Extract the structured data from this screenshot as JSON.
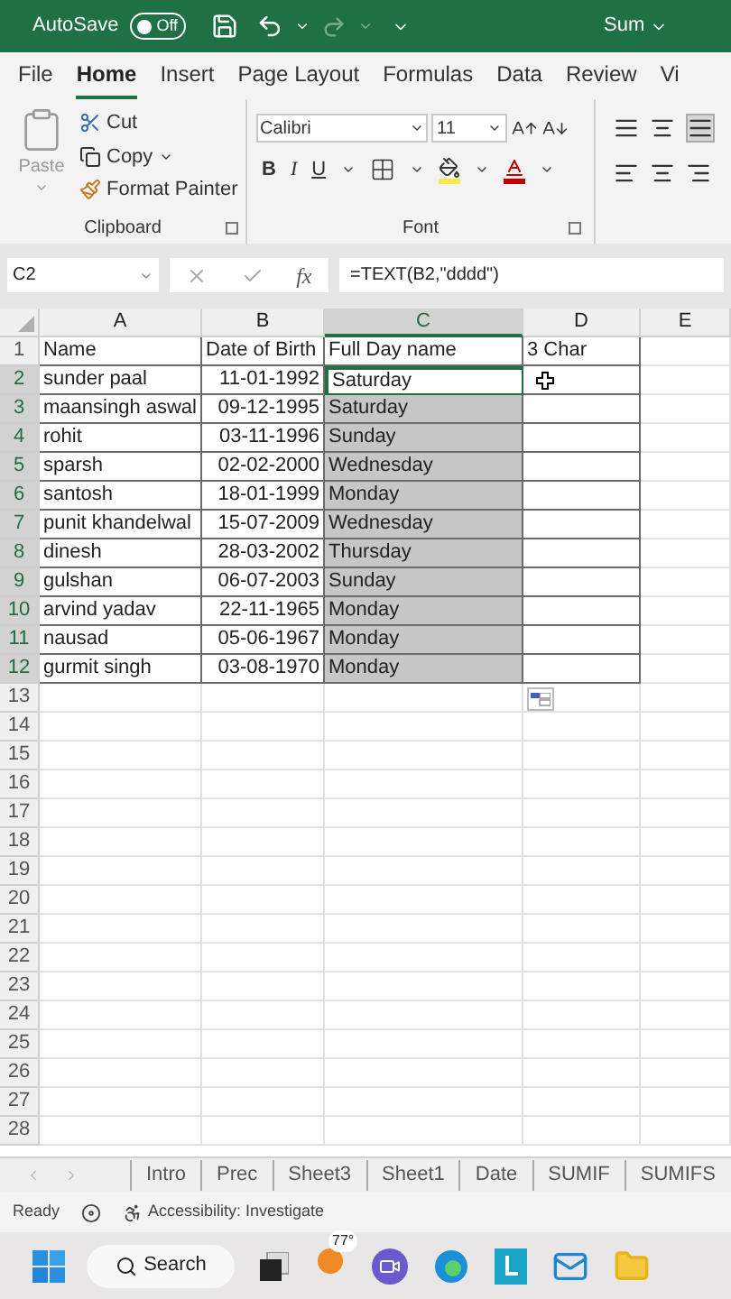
{
  "title_bar": {
    "autosave_label": "AutoSave",
    "autosave_state": "Off",
    "autosave_on": false,
    "title": "Sum"
  },
  "ribbon_tabs": [
    {
      "label": "File",
      "selected": false
    },
    {
      "label": "Home",
      "selected": true
    },
    {
      "label": "Insert",
      "selected": false
    },
    {
      "label": "Page Layout",
      "selected": false
    },
    {
      "label": "Formulas",
      "selected": false
    },
    {
      "label": "Data",
      "selected": false
    },
    {
      "label": "Review",
      "selected": false
    },
    {
      "label": "Vi",
      "selected": false
    }
  ],
  "clipboard": {
    "paste": "Paste",
    "cut": "Cut",
    "copy": "Copy",
    "format_painter": "Format Painter",
    "group_label": "Clipboard"
  },
  "font": {
    "family": "Calibri",
    "size": "11",
    "bold": "B",
    "italic": "I",
    "underline": "U",
    "group_label": "Font"
  },
  "formula_bar": {
    "name_box": "C2",
    "fx": "fx",
    "formula": "=TEXT(B2,\"dddd\")"
  },
  "sheet": {
    "columns": [
      {
        "label": "A",
        "selected": false
      },
      {
        "label": "B",
        "selected": false
      },
      {
        "label": "C",
        "selected": true
      },
      {
        "label": "D",
        "selected": false
      },
      {
        "label": "E",
        "selected": false
      }
    ],
    "rows": [
      {
        "number": "1",
        "cells": [
          "Name",
          "Date of Birth",
          "Full Day name",
          "3 Char"
        ],
        "selected": false,
        "active": false
      },
      {
        "number": "2",
        "cells": [
          "sunder paal",
          "11-01-1992",
          "Saturday"
        ],
        "selected": true,
        "active": true
      },
      {
        "number": "3",
        "cells": [
          "maansingh aswal",
          "09-12-1995",
          "Saturday"
        ],
        "selected": true,
        "active": false
      },
      {
        "number": "4",
        "cells": [
          "rohit",
          "03-11-1996",
          "Sunday"
        ],
        "selected": true,
        "active": false
      },
      {
        "number": "5",
        "cells": [
          "sparsh",
          "02-02-2000",
          "Wednesday"
        ],
        "selected": true,
        "active": false
      },
      {
        "number": "6",
        "cells": [
          "santosh",
          "18-01-1999",
          "Monday"
        ],
        "selected": true,
        "active": false
      },
      {
        "number": "7",
        "cells": [
          "punit khandelwal",
          "15-07-2009",
          "Wednesday"
        ],
        "selected": true,
        "active": false
      },
      {
        "number": "8",
        "cells": [
          "dinesh",
          "28-03-2002",
          "Thursday"
        ],
        "selected": true,
        "active": false
      },
      {
        "number": "9",
        "cells": [
          "gulshan",
          "06-07-2003",
          "Sunday"
        ],
        "selected": true,
        "active": false
      },
      {
        "number": "10",
        "cells": [
          "arvind yadav",
          "22-11-1965",
          "Monday"
        ],
        "selected": true,
        "active": false
      },
      {
        "number": "11",
        "cells": [
          "nausad",
          "05-06-1967",
          "Monday"
        ],
        "selected": true,
        "active": false
      },
      {
        "number": "12",
        "cells": [
          "gurmit singh",
          "03-08-1970",
          "Monday"
        ],
        "selected": true,
        "active": false
      },
      {
        "number": "13",
        "selected": false,
        "active": false
      },
      {
        "number": "14",
        "selected": false,
        "active": false
      },
      {
        "number": "15",
        "selected": false,
        "active": false
      },
      {
        "number": "16",
        "selected": false,
        "active": false
      },
      {
        "number": "17",
        "selected": false,
        "active": false
      },
      {
        "number": "18",
        "selected": false,
        "active": false
      },
      {
        "number": "19",
        "selected": false,
        "active": false
      },
      {
        "number": "20",
        "selected": false,
        "active": false
      },
      {
        "number": "21",
        "selected": false,
        "active": false
      },
      {
        "number": "22",
        "selected": false,
        "active": false
      },
      {
        "number": "23",
        "selected": false,
        "active": false
      },
      {
        "number": "24",
        "selected": false,
        "active": false
      },
      {
        "number": "25",
        "selected": false,
        "active": false
      },
      {
        "number": "26",
        "selected": false,
        "active": false
      },
      {
        "number": "27",
        "selected": false,
        "active": false
      },
      {
        "number": "28",
        "selected": false,
        "active": false
      }
    ]
  },
  "sheet_tabs": [
    {
      "label": "Intro",
      "selected": false
    },
    {
      "label": "Prec",
      "selected": false
    },
    {
      "label": "Sheet3",
      "selected": false
    },
    {
      "label": "Sheet1",
      "selected": false
    },
    {
      "label": "Date",
      "selected": false
    },
    {
      "label": "SUMIF",
      "selected": false
    },
    {
      "label": "SUMIFS",
      "selected": false
    }
  ],
  "status_bar": {
    "mode": "Ready",
    "accessibility": "Accessibility: Investigate"
  },
  "taskbar": {
    "search": "Search",
    "weather": "77°"
  }
}
